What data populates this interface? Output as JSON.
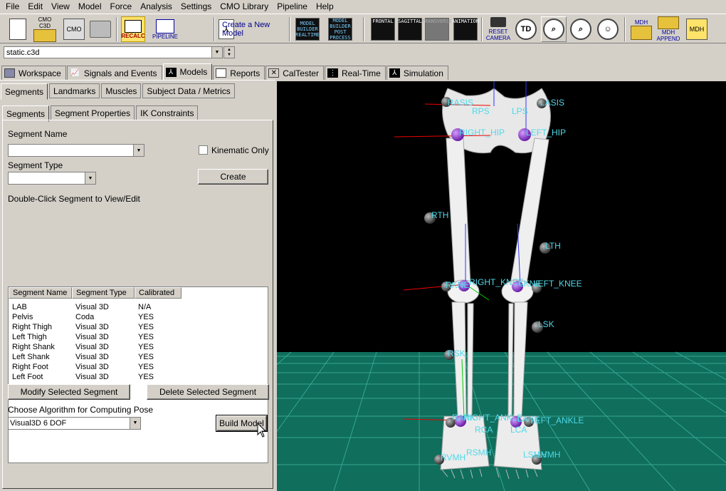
{
  "menu": [
    "File",
    "Edit",
    "View",
    "Model",
    "Force",
    "Analysis",
    "Settings",
    "CMO Library",
    "Pipeline",
    "Help"
  ],
  "toolbar": {
    "cmo_c3d": "CMO C3D",
    "cmo": "CMO",
    "recalc": "RECALC",
    "pipeline": "PIPELINE",
    "create_model": "Create a New Model",
    "model_builder_realtime": "MODEL BUILDER REALTIME",
    "model_builder_post": "MODEL BUILDER POST PROCESS",
    "frontal": "FRONTAL",
    "sagittal": "SAGITTAL",
    "transverse": "TRANSVERSE",
    "animation": "ANIMATION",
    "reset_camera": "RESET CAMERA",
    "td": "TD",
    "mdh": "MDH",
    "mdh_append": "MDH APPEND"
  },
  "file_combo": {
    "value": "static.c3d"
  },
  "main_tabs": [
    "Workspace",
    "Signals and Events",
    "Models",
    "Reports",
    "CalTester",
    "Real-Time",
    "Simulation"
  ],
  "sub_tabs_1": [
    "Segments",
    "Landmarks",
    "Muscles",
    "Subject Data / Metrics"
  ],
  "sub_tabs_2": [
    "Segments",
    "Segment Properties",
    "IK Constraints"
  ],
  "segments_panel": {
    "segment_name_label": "Segment Name",
    "kinematic_only": "Kinematic Only",
    "segment_type_label": "Segment Type",
    "create_button": "Create",
    "double_click_label": "Double-Click Segment to View/Edit",
    "columns": [
      "Segment Name",
      "Segment Type",
      "Calibrated"
    ],
    "rows": [
      [
        "LAB",
        "Visual 3D",
        "N/A"
      ],
      [
        "Pelvis",
        "Coda",
        "YES"
      ],
      [
        "Right Thigh",
        "Visual 3D",
        "YES"
      ],
      [
        "Left Thigh",
        "Visual 3D",
        "YES"
      ],
      [
        "Right Shank",
        "Visual 3D",
        "YES"
      ],
      [
        "Left Shank",
        "Visual 3D",
        "YES"
      ],
      [
        "Right Foot",
        "Visual 3D",
        "YES"
      ],
      [
        "Left Foot",
        "Visual 3D",
        "YES"
      ]
    ],
    "modify_button": "Modify Selected Segment",
    "delete_button": "Delete Selected Segment",
    "algorithm_label": "Choose Algorithm for Computing Pose",
    "algorithm_value": "Visual3D 6 DOF",
    "build_button": "Build Model"
  },
  "viewport_labels": {
    "rasis": "RASIS",
    "lasis": "LASIS",
    "rpsis": "RPS",
    "lpsis": "LPS",
    "right_hip": "RIGHT_HIP",
    "left_hip": "LEFT_HIP",
    "rth": "RTH",
    "lth": "LTH",
    "right_knee": "RIGHT_KNEE",
    "left_knee": "LEFT_KNEE",
    "rkne": "RKNE",
    "lkne": "LKNE",
    "lsk": "LSK",
    "rsk": "RSK",
    "right_ankle": "RIGHT_ANKLE",
    "left_ankle": "LEFT_ANKLE",
    "rank": "RANK",
    "lank": "LANK",
    "rca": "RCA",
    "lca": "LCA",
    "rsmh": "RSMH",
    "lsmh": "LSMH",
    "rvmh": "RVMH",
    "lvmh": "LVMH"
  },
  "colors": {
    "marker_label": "#4fd8e8",
    "floor": "#0f6e5c",
    "floor_grid": "#3fb59e",
    "joint": "#8a35c8"
  }
}
